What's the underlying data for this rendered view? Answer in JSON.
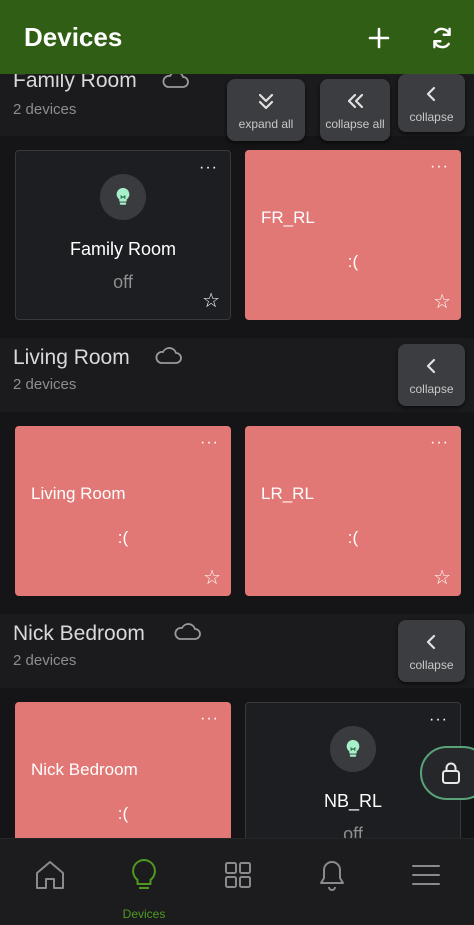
{
  "appbar": {
    "title": "Devices",
    "add_icon": "plus-icon",
    "refresh_icon": "refresh-icon",
    "color": "#2f5e14"
  },
  "rooms": [
    {
      "name": "Family Room",
      "count": "2 devices",
      "buttons": {
        "expand_all": "expand all",
        "collapse_all": "collapse all",
        "collapse": "collapse"
      },
      "devices": [
        {
          "title": "Family Room",
          "state": "off",
          "status": "ok",
          "menu": "···",
          "star": "☆"
        },
        {
          "title": "FR_RL",
          "state": ":(",
          "status": "error",
          "menu": "···",
          "star": "☆"
        }
      ]
    },
    {
      "name": "Living Room",
      "count": "2 devices",
      "buttons": {
        "collapse": "collapse"
      },
      "devices": [
        {
          "title": "Living Room",
          "state": ":(",
          "status": "error",
          "menu": "···",
          "star": "☆"
        },
        {
          "title": "LR_RL",
          "state": ":(",
          "status": "error",
          "menu": "···",
          "star": "☆"
        }
      ]
    },
    {
      "name": "Nick Bedroom",
      "count": "2 devices",
      "buttons": {
        "collapse": "collapse"
      },
      "devices": [
        {
          "title": "Nick Bedroom",
          "state": ":(",
          "status": "error",
          "menu": "···"
        },
        {
          "title": "NB_RL",
          "state": "off",
          "status": "ok",
          "menu": "···"
        }
      ]
    }
  ],
  "nav": [
    {
      "icon": "home-icon",
      "label": ""
    },
    {
      "icon": "bulb-icon",
      "label": "Devices",
      "active": true
    },
    {
      "icon": "grid-icon",
      "label": ""
    },
    {
      "icon": "bell-icon",
      "label": ""
    },
    {
      "icon": "menu-icon",
      "label": ""
    }
  ],
  "colors": {
    "error_tile": "#e27875",
    "bulb": "#a7f0c9",
    "active_nav": "#4f9a1e"
  }
}
